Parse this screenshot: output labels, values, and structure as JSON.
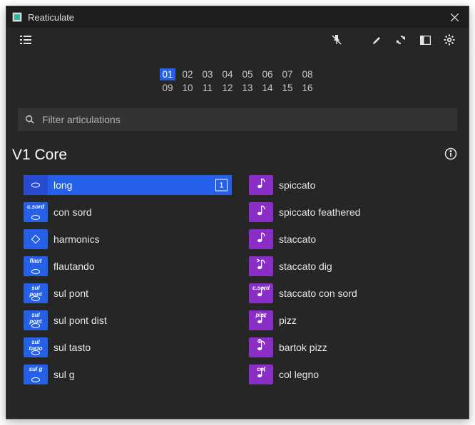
{
  "titlebar": {
    "title": "Reaticulate"
  },
  "channels": {
    "row1": [
      "01",
      "02",
      "03",
      "04",
      "05",
      "06",
      "07",
      "08"
    ],
    "row2": [
      "09",
      "10",
      "11",
      "12",
      "13",
      "14",
      "15",
      "16"
    ],
    "selected": "01"
  },
  "search": {
    "placeholder": "Filter articulations"
  },
  "section": {
    "title": "V1 Core"
  },
  "numBadge": "1",
  "left": [
    {
      "label": "long",
      "tiny": "",
      "selected": true,
      "badge": "blue",
      "icon": "whole"
    },
    {
      "label": "con sord",
      "tiny": "c.sord",
      "selected": false,
      "badge": "blue",
      "icon": "whole"
    },
    {
      "label": "harmonics",
      "tiny": "",
      "selected": false,
      "badge": "blue",
      "icon": "diamond"
    },
    {
      "label": "flautando",
      "tiny": "flaut",
      "selected": false,
      "badge": "blue",
      "icon": "whole"
    },
    {
      "label": "sul pont",
      "tiny": "sul pont",
      "selected": false,
      "badge": "blue",
      "icon": "whole"
    },
    {
      "label": "sul pont dist",
      "tiny": "sul pont",
      "selected": false,
      "badge": "blue",
      "icon": "whole"
    },
    {
      "label": "sul tasto",
      "tiny": "sul tasto",
      "selected": false,
      "badge": "blue",
      "icon": "whole"
    },
    {
      "label": "sul g",
      "tiny": "sul g",
      "selected": false,
      "badge": "blue",
      "icon": "whole"
    }
  ],
  "right": [
    {
      "label": "spiccato",
      "tiny": "",
      "selected": false,
      "badge": "purple",
      "icon": "eighth-up"
    },
    {
      "label": "spiccato feathered",
      "tiny": "",
      "selected": false,
      "badge": "purple",
      "icon": "feather"
    },
    {
      "label": "staccato",
      "tiny": "",
      "selected": false,
      "badge": "purple",
      "icon": "eighth"
    },
    {
      "label": "staccato dig",
      "tiny": "",
      "selected": false,
      "badge": "purple",
      "icon": "eighth-accent"
    },
    {
      "label": "staccato con sord",
      "tiny": "c.sord",
      "selected": false,
      "badge": "purple",
      "icon": "eighth"
    },
    {
      "label": "pizz",
      "tiny": "pizz",
      "selected": false,
      "badge": "purple",
      "icon": "eighth"
    },
    {
      "label": "bartok pizz",
      "tiny": "",
      "selected": false,
      "badge": "purple",
      "icon": "bartok"
    },
    {
      "label": "col legno",
      "tiny": "col",
      "selected": false,
      "badge": "purple",
      "icon": "eighth"
    }
  ]
}
